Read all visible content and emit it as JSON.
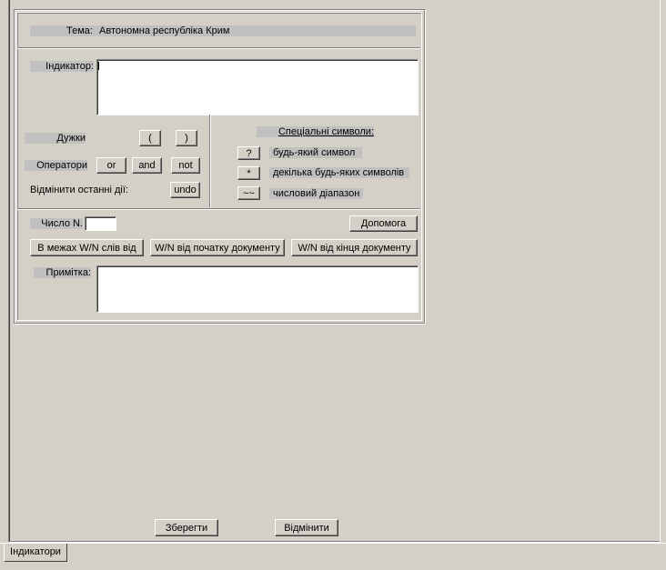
{
  "theme": {
    "label": "Тема:",
    "value": "Автономна республіка Крим"
  },
  "indicator": {
    "label": "Індикатор:"
  },
  "brackets": {
    "label": "Дужки",
    "open": "(",
    "close": ")"
  },
  "operators": {
    "label": "Оператори",
    "or": "or",
    "and": "and",
    "not": "not"
  },
  "undo": {
    "label": "Відмінити останні дії:",
    "button": "undo"
  },
  "special": {
    "title": "Спеціальні символи:",
    "items": [
      {
        "button": "?",
        "desc": "будь-який символ"
      },
      {
        "button": "*",
        "desc": "декілька будь-яких символів"
      },
      {
        "button": "~~",
        "desc": "числовий діапазон"
      }
    ]
  },
  "number": {
    "label": "Число N.",
    "value": ""
  },
  "help_button": "Допомога",
  "range_buttons": {
    "within": "В межах W/N слів від",
    "from_start": "W/N від початку документу",
    "from_end": "W/N від кінця документу"
  },
  "note": {
    "label": "Примітка:"
  },
  "save_button": "Зберегти",
  "cancel_button": "Відмінити",
  "tab_label": "Індикатори"
}
